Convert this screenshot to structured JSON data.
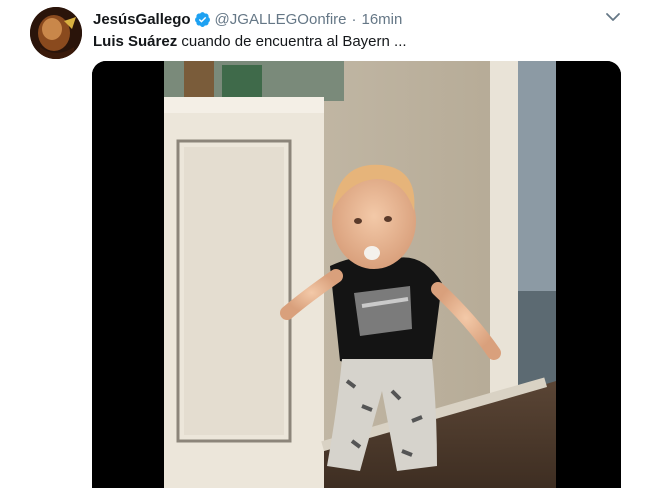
{
  "tweet": {
    "display_name": "JesúsGallego",
    "verified_icon": "verified-badge-icon",
    "handle": "@JGALLEGOonfire",
    "separator": "·",
    "timestamp": "16min",
    "text_bold": "Luis Suárez",
    "text_rest": " cuando de encuentra al Bayern ...",
    "menu_icon": "chevron-down-icon",
    "media_type": "video"
  },
  "colors": {
    "accent_blue": "#1da1f2",
    "secondary_text": "#657786",
    "primary_text": "#14171a"
  }
}
